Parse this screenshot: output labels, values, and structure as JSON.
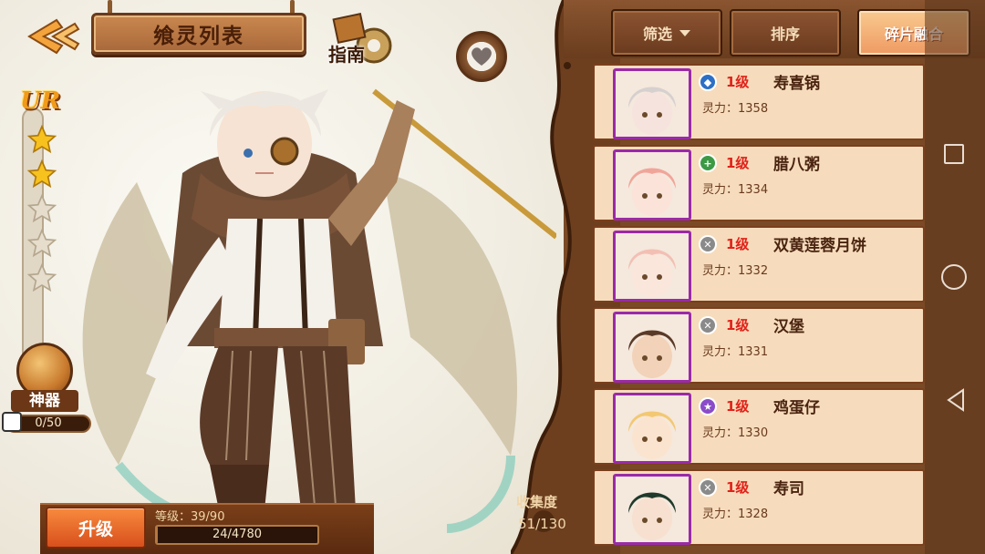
{
  "screen_title": "飨灵列表",
  "guide_label": "指南",
  "rarity": {
    "label": "UR",
    "stars": 2,
    "max_stars": 5
  },
  "artifact": {
    "label": "神器",
    "progress_text": "0/50",
    "progress": 0.0
  },
  "level_panel": {
    "upgrade_label": "升级",
    "grade_text": "等级：39/90",
    "xp_text": "24/4780",
    "xp_progress": 0.005
  },
  "collection": {
    "label": "收集度",
    "value": "51/130"
  },
  "toolbar": {
    "filter_label": "筛选",
    "sort_label": "排序",
    "merge_label": "碎片融合"
  },
  "colors": {
    "accent": "#ef9a63",
    "wood": "#6a3d1e",
    "frame": "#9a2aa8",
    "level": "#e0221a"
  },
  "roster": [
    {
      "level": "1级",
      "name": "寿喜锅",
      "power": "灵力：1358",
      "badge_icon": "shield-icon",
      "badge_color": "#2d6fc4",
      "hair": "#d6d0cf",
      "skin": "#f6e3dd"
    },
    {
      "level": "1级",
      "name": "腊八粥",
      "power": "灵力：1334",
      "badge_icon": "heal-icon",
      "badge_color": "#3c9a45",
      "hair": "#f1a59a",
      "skin": "#fbe3da"
    },
    {
      "level": "1级",
      "name": "双黄莲蓉月饼",
      "power": "灵力：1332",
      "badge_icon": "sword-icon",
      "badge_color": "#8a8a8a",
      "hair": "#f3bfb4",
      "skin": "#fbe6dc"
    },
    {
      "level": "1级",
      "name": "汉堡",
      "power": "灵力：1331",
      "badge_icon": "sword-icon",
      "badge_color": "#8a8a8a",
      "hair": "#5a3a28",
      "skin": "#f2d2b8"
    },
    {
      "level": "1级",
      "name": "鸡蛋仔",
      "power": "灵力：1330",
      "badge_icon": "star-icon",
      "badge_color": "#8a4cc8",
      "hair": "#f2c872",
      "skin": "#fbe4cf"
    },
    {
      "level": "1级",
      "name": "寿司",
      "power": "灵力：1328",
      "badge_icon": "sword-icon",
      "badge_color": "#8a8a8a",
      "hair": "#1f3a2a",
      "skin": "#f7e0cf"
    }
  ]
}
